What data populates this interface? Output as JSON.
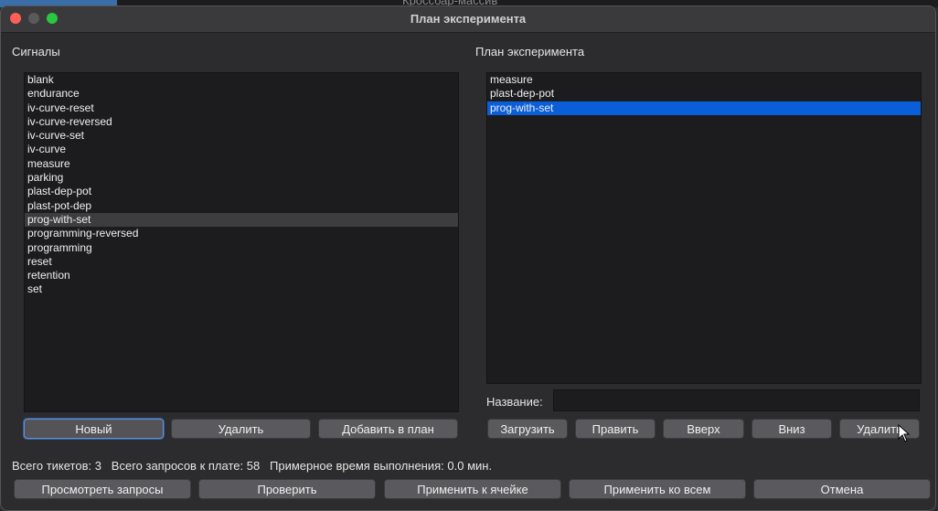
{
  "background_app": {
    "title": "Кроссбар-массив"
  },
  "window": {
    "title": "План эксперимента"
  },
  "signals": {
    "label": "Сигналы",
    "items": [
      "blank",
      "endurance",
      "iv-curve-reset",
      "iv-curve-reversed",
      "iv-curve-set",
      "iv-curve",
      "measure",
      "parking",
      "plast-dep-pot",
      "plast-pot-dep",
      "prog-with-set",
      "programming-reversed",
      "programming",
      "reset",
      "retention",
      "set"
    ],
    "highlighted": "prog-with-set",
    "buttons": {
      "new": "Новый",
      "delete": "Удалить",
      "add_to_plan": "Добавить в план"
    }
  },
  "plan": {
    "label": "План эксперимента",
    "items": [
      "measure",
      "plast-dep-pot",
      "prog-with-set"
    ],
    "selected": "prog-with-set",
    "name_label": "Название:",
    "name_value": "",
    "buttons": {
      "load": "Загрузить",
      "edit": "Править",
      "up": "Вверх",
      "down": "Вниз",
      "delete": "Удалить"
    }
  },
  "status": {
    "tickets": "Всего тикетов: 3",
    "requests": "Всего запросов к плате: 58",
    "time": "Примерное время выполнения: 0.0 мин."
  },
  "bottom_buttons": {
    "view_requests": "Просмотреть запросы",
    "check": "Проверить",
    "apply_cell": "Применить к ячейке",
    "apply_all": "Применить ко всем",
    "cancel": "Отмена"
  },
  "colors": {
    "selection": "#0a5ed8",
    "list_bg": "#1c1c1e",
    "window_bg": "#2c2c2e"
  }
}
